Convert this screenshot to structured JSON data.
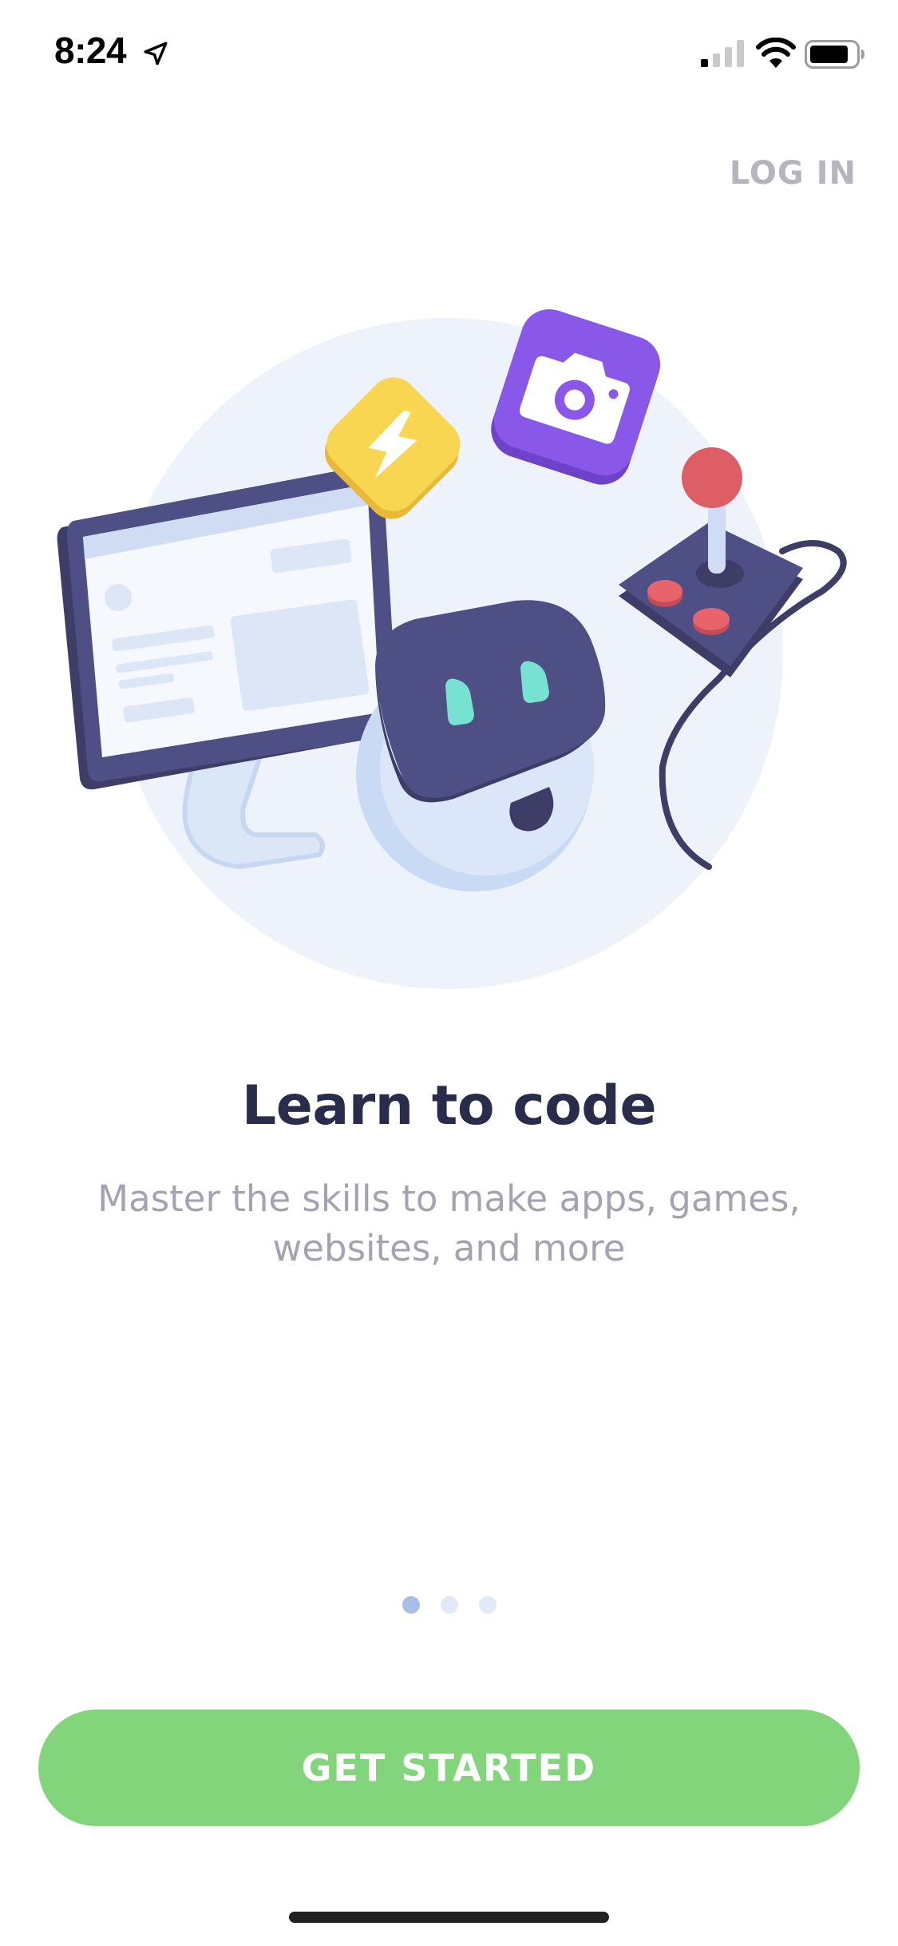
{
  "status_bar": {
    "time": "8:24",
    "icons": [
      "location-arrow-icon",
      "cellular-signal-icon",
      "wifi-icon",
      "battery-icon"
    ]
  },
  "header": {
    "login_label": "LOG IN"
  },
  "onboarding": {
    "illustration": "robot-with-monitor-joystick-camera-lightning",
    "title": "Learn to code",
    "subtitle_line1": "Master the skills to make apps, games,",
    "subtitle_line2": "websites, and more",
    "page_count": 3,
    "active_page": 1
  },
  "cta": {
    "get_started_label": "GET STARTED"
  },
  "colors": {
    "accent_green": "#82d57a",
    "title_navy": "#2a2c4c",
    "subtitle_gray": "#a3a3b1",
    "login_gray": "#b5b5bf",
    "dot_active": "#a7bfe9",
    "dot_inactive": "#e2eaf8"
  }
}
